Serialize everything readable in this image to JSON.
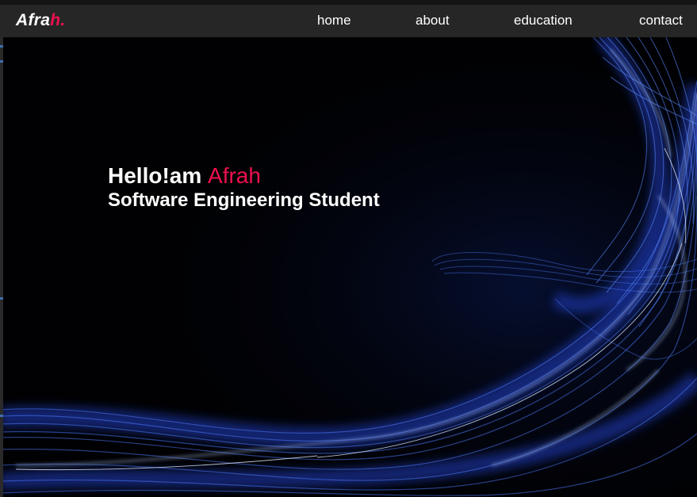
{
  "brand": {
    "logo_main": "Afra",
    "logo_accent": "h."
  },
  "nav": {
    "items": [
      {
        "label": "home"
      },
      {
        "label": "about"
      },
      {
        "label": "education"
      },
      {
        "label": "contact"
      }
    ]
  },
  "hero": {
    "greeting": "Hello!am",
    "name": "Afrah",
    "subtitle": "Software Engineering Student"
  },
  "colors": {
    "accent": "#f0104f",
    "navbar": "#262626",
    "background": "#000000",
    "wave": "#3a6cff"
  }
}
